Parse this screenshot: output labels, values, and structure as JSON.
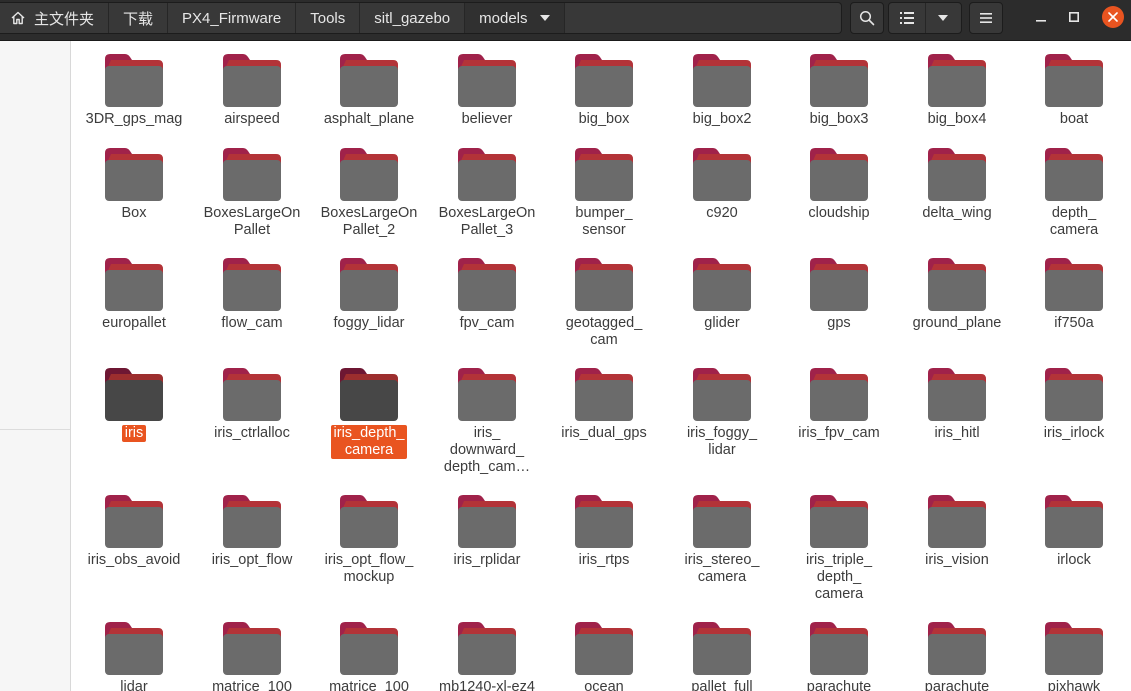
{
  "breadcrumbs": [
    "主文件夹",
    "下载",
    "PX4_Firmware",
    "Tools",
    "sitl_gazebo",
    "models"
  ],
  "colors": {
    "accent": "#e95420",
    "folder_tab": "#a0224a",
    "folder_body": "#6b6b6b"
  },
  "icons": [
    "home-icon",
    "search-icon",
    "list-view-icon",
    "chevron-down-icon",
    "menu-icon",
    "minimize-icon",
    "maximize-icon",
    "close-icon",
    "folder-icon"
  ],
  "files": [
    {
      "name": "3DR_gps_mag"
    },
    {
      "name": "airspeed"
    },
    {
      "name": "asphalt_plane"
    },
    {
      "name": "believer"
    },
    {
      "name": "big_box"
    },
    {
      "name": "big_box2"
    },
    {
      "name": "big_box3"
    },
    {
      "name": "big_box4"
    },
    {
      "name": "boat"
    },
    {
      "name": "Box"
    },
    {
      "name": "BoxesLargeOn\nPallet"
    },
    {
      "name": "BoxesLargeOn\nPallet_2"
    },
    {
      "name": "BoxesLargeOn\nPallet_3"
    },
    {
      "name": "bumper_\nsensor"
    },
    {
      "name": "c920"
    },
    {
      "name": "cloudship"
    },
    {
      "name": "delta_wing"
    },
    {
      "name": "depth_\ncamera"
    },
    {
      "name": "europallet"
    },
    {
      "name": "flow_cam"
    },
    {
      "name": "foggy_lidar"
    },
    {
      "name": "fpv_cam"
    },
    {
      "name": "geotagged_\ncam"
    },
    {
      "name": "glider"
    },
    {
      "name": "gps"
    },
    {
      "name": "ground_plane"
    },
    {
      "name": "if750a"
    },
    {
      "name": "iris",
      "selected": true
    },
    {
      "name": "iris_ctrlalloc"
    },
    {
      "name": "iris_depth_\ncamera",
      "selected": true
    },
    {
      "name": "iris_\ndownward_\ndepth_cam…"
    },
    {
      "name": "iris_dual_gps"
    },
    {
      "name": "iris_foggy_\nlidar"
    },
    {
      "name": "iris_fpv_cam"
    },
    {
      "name": "iris_hitl"
    },
    {
      "name": "iris_irlock"
    },
    {
      "name": "iris_obs_avoid"
    },
    {
      "name": "iris_opt_flow"
    },
    {
      "name": "iris_opt_flow_\nmockup"
    },
    {
      "name": "iris_rplidar"
    },
    {
      "name": "iris_rtps"
    },
    {
      "name": "iris_stereo_\ncamera"
    },
    {
      "name": "iris_triple_\ndepth_\ncamera"
    },
    {
      "name": "iris_vision"
    },
    {
      "name": "irlock"
    },
    {
      "name": "lidar"
    },
    {
      "name": "matrice_100"
    },
    {
      "name": "matrice_100"
    },
    {
      "name": "mb1240-xl-ez4"
    },
    {
      "name": "ocean"
    },
    {
      "name": "pallet_full"
    },
    {
      "name": "parachute"
    },
    {
      "name": "parachute"
    },
    {
      "name": "pixhawk"
    }
  ]
}
